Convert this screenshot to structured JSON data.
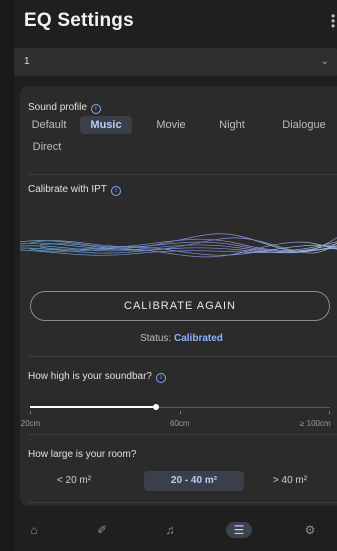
{
  "header": {
    "title": "EQ Settings"
  },
  "selector": {
    "value": "1"
  },
  "sound_profile": {
    "label": "Sound profile",
    "options": [
      "Default",
      "Music",
      "Movie",
      "Night",
      "Dialogue",
      "Direct"
    ],
    "selected": "Music"
  },
  "calibrate": {
    "label": "Calibrate with IPT",
    "button_label": "CALIBRATE AGAIN",
    "status_label": "Status:",
    "status_value": "Calibrated"
  },
  "soundbar_height": {
    "label": "How high is your soundbar?",
    "ticks": [
      "≤ 20cm",
      "60cm",
      "≥ 100cm"
    ],
    "value_fraction": 0.42
  },
  "room_size": {
    "label": "How large is your room?",
    "options": [
      "< 20 m²",
      "20 - 40 m²",
      "> 40 m²"
    ],
    "selected": "20 - 40 m²"
  },
  "nav": {
    "items": [
      "home-icon",
      "guitar-pick-icon",
      "music-note-icon",
      "equalizer-icon",
      "settings-icon"
    ],
    "active": "equalizer-icon"
  },
  "colors": {
    "accent": "#8fb1ff",
    "card": "#2b2b2b",
    "background": "#1f1f1f"
  }
}
